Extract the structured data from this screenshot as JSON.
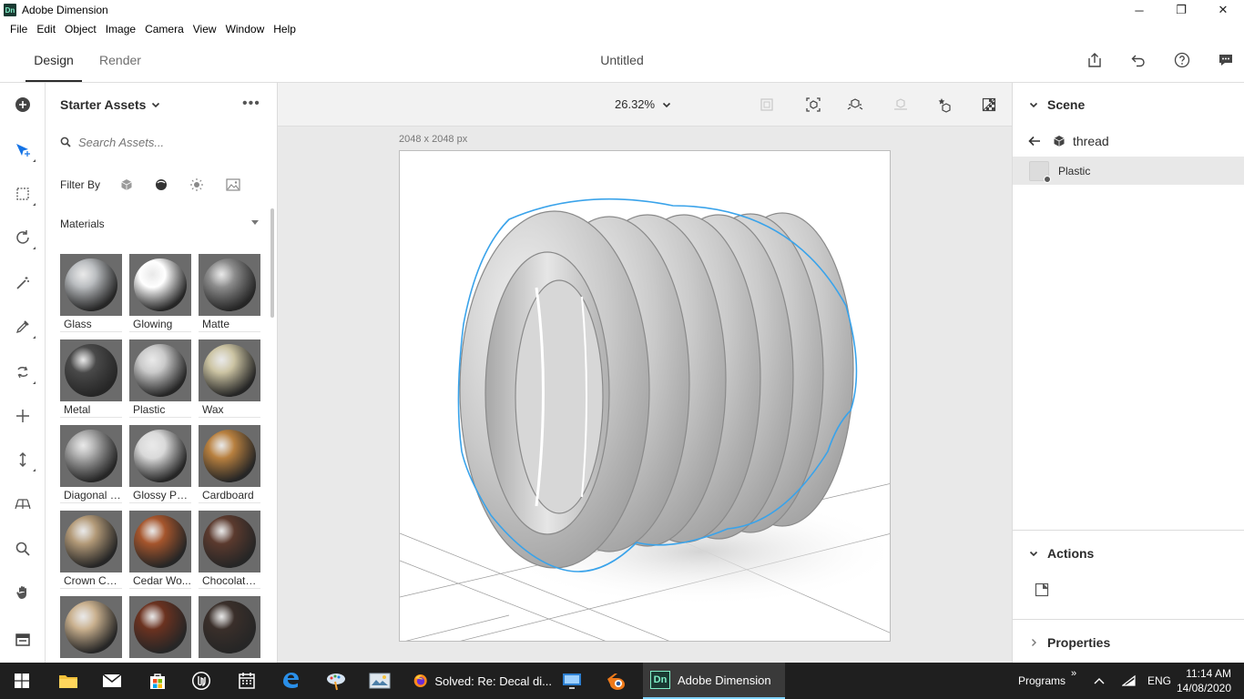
{
  "window": {
    "app_logo": "Dn",
    "title": "Adobe Dimension",
    "controls": {
      "minimize": "─",
      "restore": "❐",
      "close": "✕"
    }
  },
  "menu": [
    "File",
    "Edit",
    "Object",
    "Image",
    "Camera",
    "View",
    "Window",
    "Help"
  ],
  "header": {
    "tabs": [
      {
        "label": "Design",
        "active": true
      },
      {
        "label": "Render",
        "active": false
      }
    ],
    "document_title": "Untitled",
    "icons": [
      "share-icon",
      "undo-icon",
      "help-icon",
      "comment-icon"
    ]
  },
  "toolbar": {
    "tools": [
      "add-icon",
      "select-move-icon",
      "marquee-select-icon",
      "orbit-icon",
      "magic-wand-icon",
      "eyedropper-icon",
      "sample-icon",
      "move-icon",
      "dolly-icon",
      "horizon-icon",
      "zoom-icon",
      "pan-icon",
      "panel-toggle-icon"
    ]
  },
  "assets": {
    "title": "Starter Assets",
    "more": "•••",
    "search_placeholder": "Search Assets...",
    "filter_label": "Filter By",
    "filter_icons": [
      "models-filter-icon",
      "materials-filter-icon",
      "lights-filter-icon",
      "images-filter-icon"
    ],
    "section": "Materials",
    "materials": [
      {
        "label": "Glass",
        "color": "#b9bcbf"
      },
      {
        "label": "Glowing",
        "color": "#ffffff"
      },
      {
        "label": "Matte",
        "color": "#8d8d8d"
      },
      {
        "label": "Metal",
        "color": "#4a4a4a"
      },
      {
        "label": "Plastic",
        "color": "#c9c9c9"
      },
      {
        "label": "Wax",
        "color": "#cbc3a2"
      },
      {
        "label": "Diagonal P...",
        "color": "#a9a9a9"
      },
      {
        "label": "Glossy Pap...",
        "color": "#d9d9d9"
      },
      {
        "label": "Cardboard",
        "color": "#b8803f"
      },
      {
        "label": "Crown Cut...",
        "color": "#b39a78"
      },
      {
        "label": "Cedar Wo...",
        "color": "#a5552c"
      },
      {
        "label": "Chocolate ...",
        "color": "#5b3a2e"
      },
      {
        "label": "",
        "color": "#c9b08e"
      },
      {
        "label": "",
        "color": "#6b3220"
      },
      {
        "label": "",
        "color": "#3a2f2a"
      }
    ]
  },
  "canvas": {
    "zoom": "26.32%",
    "doc_size": "2048 x 2048 px",
    "toolbar_icons": [
      "fit-icon",
      "frame-selection-icon",
      "drop-to-ground-icon",
      "align-icon",
      "favorite-view-icon",
      "render-preview-icon"
    ]
  },
  "scene": {
    "title": "Scene",
    "object": "thread",
    "layer": "Plastic",
    "actions_title": "Actions",
    "properties_title": "Properties"
  },
  "taskbar": {
    "items": [
      {
        "name": "start-button",
        "label": ""
      },
      {
        "name": "file-explorer",
        "label": ""
      },
      {
        "name": "mail",
        "label": ""
      },
      {
        "name": "store",
        "label": ""
      },
      {
        "name": "unreal-engine",
        "label": ""
      },
      {
        "name": "calendar",
        "label": ""
      },
      {
        "name": "edge",
        "label": ""
      },
      {
        "name": "paint",
        "label": ""
      },
      {
        "name": "photos",
        "label": ""
      },
      {
        "name": "firefox",
        "label": "Solved: Re: Decal di..."
      },
      {
        "name": "remote-desktop",
        "label": ""
      },
      {
        "name": "blender",
        "label": ""
      },
      {
        "name": "adobe-dimension",
        "label": "Adobe Dimension",
        "active": true
      }
    ],
    "tray_programs": "Programs",
    "tray_more": "»",
    "language": "ENG",
    "time": "11:14 AM",
    "date": "14/08/2020",
    "colors": {
      "accent": "#7fd3ff",
      "dimension_logo_bg": "#1a3a32",
      "dimension_logo_fg": "#7ff0c8"
    }
  }
}
